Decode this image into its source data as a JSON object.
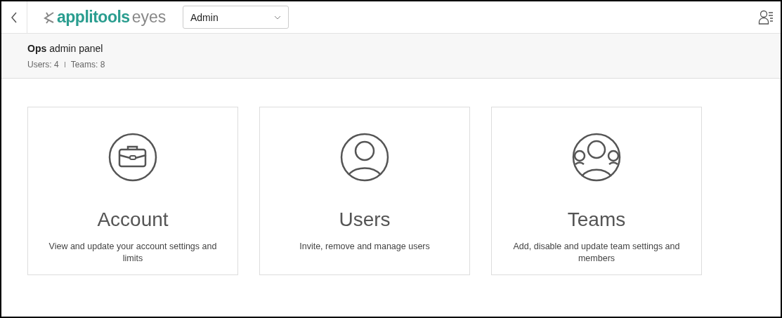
{
  "header": {
    "logo": {
      "brand": "applitools",
      "product": "eyes"
    },
    "account_select": {
      "value": "Admin"
    }
  },
  "panel": {
    "title_bold": "Ops",
    "title_rest": "admin panel",
    "stats": [
      "Users: 4",
      "Teams: 8"
    ]
  },
  "cards": [
    {
      "title": "Account",
      "description": "View and update your account settings and limits"
    },
    {
      "title": "Users",
      "description": "Invite, remove and manage users"
    },
    {
      "title": "Teams",
      "description": "Add, disable and update team settings and members"
    }
  ]
}
